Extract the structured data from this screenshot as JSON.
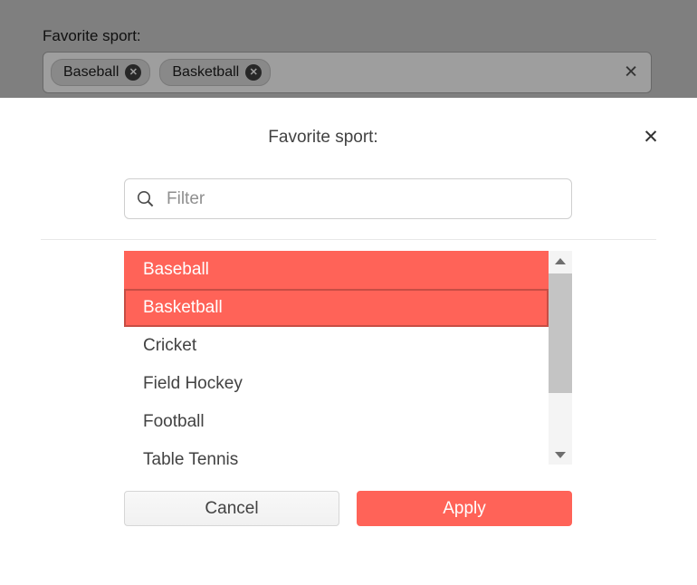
{
  "background_form": {
    "label": "Favorite sport:",
    "chips": [
      {
        "label": "Baseball"
      },
      {
        "label": "Basketball"
      }
    ],
    "chip_remove_glyph": "✕",
    "clear_glyph": "✕"
  },
  "sheet": {
    "title": "Favorite sport:",
    "close_glyph": "✕",
    "filter": {
      "placeholder": "Filter",
      "value": ""
    },
    "options": [
      {
        "label": "Baseball",
        "selected": true,
        "focused": false
      },
      {
        "label": "Basketball",
        "selected": true,
        "focused": true
      },
      {
        "label": "Cricket",
        "selected": false,
        "focused": false
      },
      {
        "label": "Field Hockey",
        "selected": false,
        "focused": false
      },
      {
        "label": "Football",
        "selected": false,
        "focused": false
      },
      {
        "label": "Table Tennis",
        "selected": false,
        "focused": false
      }
    ],
    "cancel_label": "Cancel",
    "apply_label": "Apply"
  },
  "colors": {
    "primary": "#ff6358",
    "overlay": "rgba(0,0,0,0.38)",
    "selected_text": "#ffffff",
    "text_dark": "#424242"
  }
}
